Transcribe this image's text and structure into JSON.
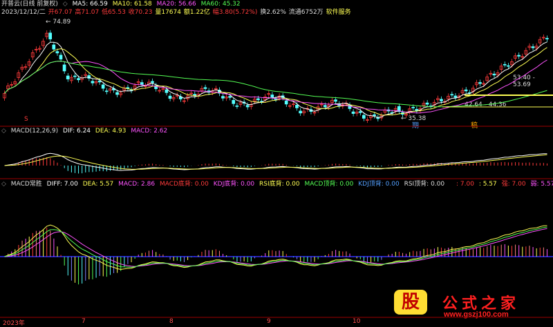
{
  "header": {
    "app_title": "开普云(日线 前复权)",
    "ma5": "MA5: 66.59",
    "ma10": "MA10: 61.58",
    "ma20": "MA20: 56.66",
    "ma60": "MA60: 45.32"
  },
  "info_row": {
    "date": "2023/12/12/二",
    "open": "开67.07",
    "high": "高71.07",
    "low": "低65.53",
    "close": "收70.23",
    "volume": "量17674",
    "amount": "额1.22亿",
    "change": "幅3.80(5.72%)",
    "turnover": "换2.62%",
    "float": "流通6752万",
    "sector": "软件服务"
  },
  "price_annotations": {
    "high_label": "74.89",
    "low_label": "35.38",
    "right_label_1": "53.40 - 53.69",
    "right_label_2": "42.64 - 44.36",
    "signal_s": "S",
    "signal_buy": "期",
    "signal_right": "稿"
  },
  "macd_panel": {
    "title": "MACD(12,26,9)",
    "dif": "DIF: 6.24",
    "dea": "DEA: 4.93",
    "macd": "MACD: 2.62"
  },
  "indicator_panel": {
    "title": "MACD常胜",
    "diff": "DIFF: 7.00",
    "dea": "DEA: 5.57",
    "macd": "MACD: 2.86",
    "macd_bottom_div": "MACD底背: 0.00",
    "kdj_bottom_div": "KDJ底背: 0.00",
    "rsi_bottom_div": "RSI底背: 0.00",
    "macd_top_div": "MACD顶背: 0.00",
    "kdj_top_div": "KDJ顶背: 0.00",
    "rsi_top_div": "RSI顶背: 0.00",
    "right_1": ": 7.00",
    "right_2": ": 5.57",
    "right_3": "强: 7.00",
    "right_4": "弱: 5.57"
  },
  "time_axis": {
    "labels": [
      "2023年",
      "7",
      "8",
      "9",
      "10"
    ]
  },
  "watermark": {
    "logo_glyph": "股",
    "site_name": "公式之家",
    "url": "www.gszj100.com"
  },
  "colors": {
    "up": "#ff3b3b",
    "down": "#54ffff",
    "ma5": "#ffffff",
    "ma10": "#ffff54",
    "ma20": "#ff54ff",
    "ma60": "#54ff54",
    "axis": "#a00000"
  }
}
